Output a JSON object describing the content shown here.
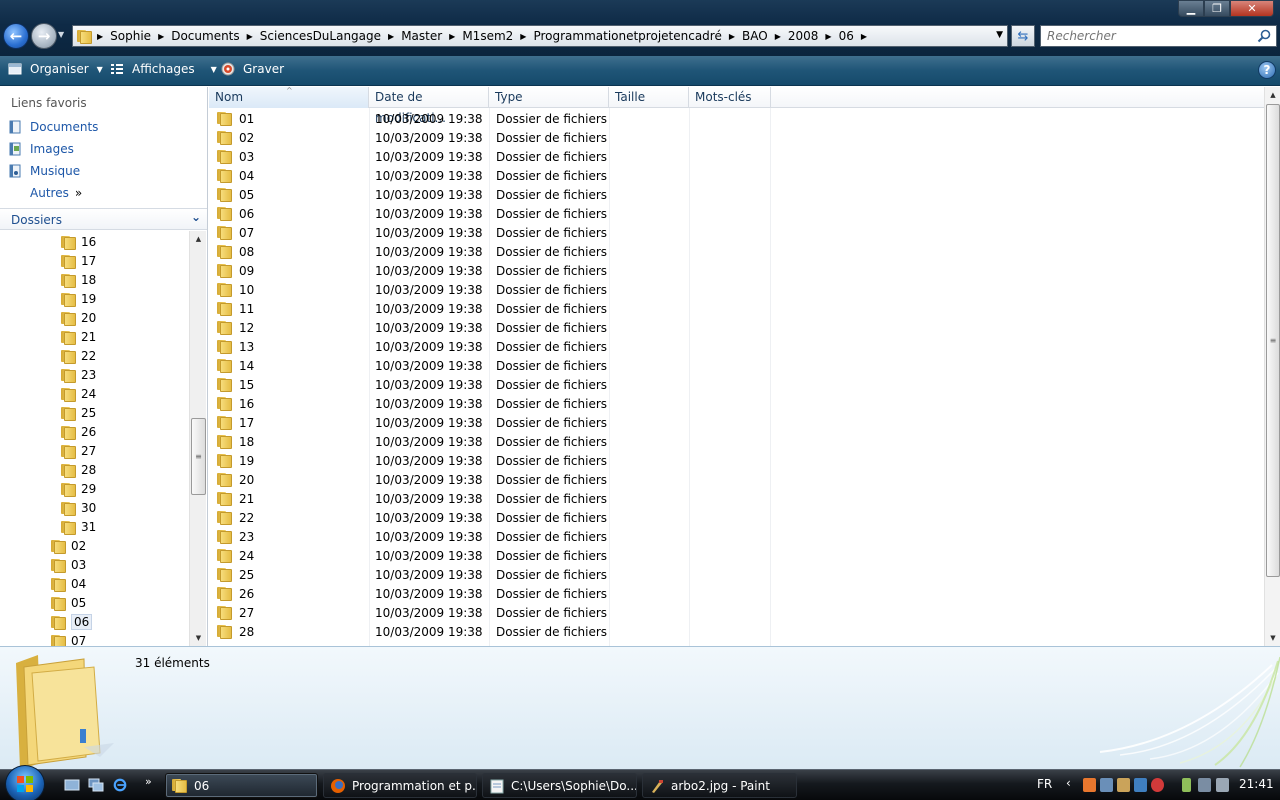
{
  "window": {
    "controls": {
      "minimize": "▁",
      "maximize": "❐",
      "close": "✕"
    }
  },
  "address": {
    "crumbs": [
      "Sophie",
      "Documents",
      "SciencesDuLangage",
      "Master",
      "M1sem2",
      "Programmationetprojetencadré",
      "BAO",
      "2008",
      "06"
    ]
  },
  "search": {
    "placeholder": "Rechercher"
  },
  "toolbar": {
    "organize": "Organiser",
    "views": "Affichages",
    "burn": "Graver",
    "help": "?"
  },
  "favorites": {
    "title": "Liens favoris",
    "items": [
      "Documents",
      "Images",
      "Musique"
    ],
    "more": "Autres",
    "more_chevron": "»"
  },
  "folders": {
    "title": "Dossiers",
    "chevron": "⌄",
    "tree": [
      {
        "label": "16",
        "level": 2
      },
      {
        "label": "17",
        "level": 2
      },
      {
        "label": "18",
        "level": 2
      },
      {
        "label": "19",
        "level": 2
      },
      {
        "label": "20",
        "level": 2
      },
      {
        "label": "21",
        "level": 2
      },
      {
        "label": "22",
        "level": 2
      },
      {
        "label": "23",
        "level": 2
      },
      {
        "label": "24",
        "level": 2
      },
      {
        "label": "25",
        "level": 2
      },
      {
        "label": "26",
        "level": 2
      },
      {
        "label": "27",
        "level": 2
      },
      {
        "label": "28",
        "level": 2
      },
      {
        "label": "29",
        "level": 2
      },
      {
        "label": "30",
        "level": 2
      },
      {
        "label": "31",
        "level": 2
      },
      {
        "label": "02",
        "level": 1
      },
      {
        "label": "03",
        "level": 1
      },
      {
        "label": "04",
        "level": 1
      },
      {
        "label": "05",
        "level": 1
      },
      {
        "label": "06",
        "level": 1,
        "selected": true
      },
      {
        "label": "07",
        "level": 1
      }
    ]
  },
  "columns": [
    "Nom",
    "Date de modificati...",
    "Type",
    "Taille",
    "Mots-clés"
  ],
  "files": [
    {
      "name": "01",
      "date": "10/03/2009 19:38",
      "type": "Dossier de fichiers"
    },
    {
      "name": "02",
      "date": "10/03/2009 19:38",
      "type": "Dossier de fichiers"
    },
    {
      "name": "03",
      "date": "10/03/2009 19:38",
      "type": "Dossier de fichiers"
    },
    {
      "name": "04",
      "date": "10/03/2009 19:38",
      "type": "Dossier de fichiers"
    },
    {
      "name": "05",
      "date": "10/03/2009 19:38",
      "type": "Dossier de fichiers"
    },
    {
      "name": "06",
      "date": "10/03/2009 19:38",
      "type": "Dossier de fichiers"
    },
    {
      "name": "07",
      "date": "10/03/2009 19:38",
      "type": "Dossier de fichiers"
    },
    {
      "name": "08",
      "date": "10/03/2009 19:38",
      "type": "Dossier de fichiers"
    },
    {
      "name": "09",
      "date": "10/03/2009 19:38",
      "type": "Dossier de fichiers"
    },
    {
      "name": "10",
      "date": "10/03/2009 19:38",
      "type": "Dossier de fichiers"
    },
    {
      "name": "11",
      "date": "10/03/2009 19:38",
      "type": "Dossier de fichiers"
    },
    {
      "name": "12",
      "date": "10/03/2009 19:38",
      "type": "Dossier de fichiers"
    },
    {
      "name": "13",
      "date": "10/03/2009 19:38",
      "type": "Dossier de fichiers"
    },
    {
      "name": "14",
      "date": "10/03/2009 19:38",
      "type": "Dossier de fichiers"
    },
    {
      "name": "15",
      "date": "10/03/2009 19:38",
      "type": "Dossier de fichiers"
    },
    {
      "name": "16",
      "date": "10/03/2009 19:38",
      "type": "Dossier de fichiers"
    },
    {
      "name": "17",
      "date": "10/03/2009 19:38",
      "type": "Dossier de fichiers"
    },
    {
      "name": "18",
      "date": "10/03/2009 19:38",
      "type": "Dossier de fichiers"
    },
    {
      "name": "19",
      "date": "10/03/2009 19:38",
      "type": "Dossier de fichiers"
    },
    {
      "name": "20",
      "date": "10/03/2009 19:38",
      "type": "Dossier de fichiers"
    },
    {
      "name": "21",
      "date": "10/03/2009 19:38",
      "type": "Dossier de fichiers"
    },
    {
      "name": "22",
      "date": "10/03/2009 19:38",
      "type": "Dossier de fichiers"
    },
    {
      "name": "23",
      "date": "10/03/2009 19:38",
      "type": "Dossier de fichiers"
    },
    {
      "name": "24",
      "date": "10/03/2009 19:38",
      "type": "Dossier de fichiers"
    },
    {
      "name": "25",
      "date": "10/03/2009 19:38",
      "type": "Dossier de fichiers"
    },
    {
      "name": "26",
      "date": "10/03/2009 19:38",
      "type": "Dossier de fichiers"
    },
    {
      "name": "27",
      "date": "10/03/2009 19:38",
      "type": "Dossier de fichiers"
    },
    {
      "name": "28",
      "date": "10/03/2009 19:38",
      "type": "Dossier de fichiers"
    }
  ],
  "details": {
    "count": "31 éléments"
  },
  "taskbar": {
    "quicklaunch_more": "»",
    "tasks": [
      {
        "label": "06",
        "icon": "explorer-folder-icon",
        "active": true
      },
      {
        "label": "Programmation et p...",
        "icon": "firefox-icon",
        "active": false
      },
      {
        "label": "C:\\Users\\Sophie\\Do...",
        "icon": "notepad-icon",
        "active": false
      },
      {
        "label": "arbo2.jpg - Paint",
        "icon": "paint-icon",
        "active": false
      }
    ],
    "language": "FR",
    "tray_arrow": "‹",
    "clock": "21:41"
  },
  "colors": {
    "accent": "#1d57a8",
    "titlebar": "#0e2a46",
    "commandbar": "#1f5577",
    "folder": "#f2cf62"
  }
}
